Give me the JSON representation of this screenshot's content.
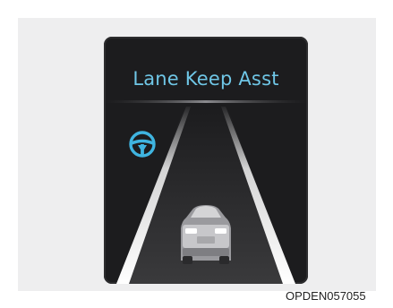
{
  "display": {
    "title": "Lane Keep Asst",
    "steering_icon": "steering-wheel-icon",
    "car_icon": "car-rear-icon",
    "title_color": "#6fc6e6",
    "icon_color": "#3fb4e0"
  },
  "figure_code": "OPDEN057055"
}
